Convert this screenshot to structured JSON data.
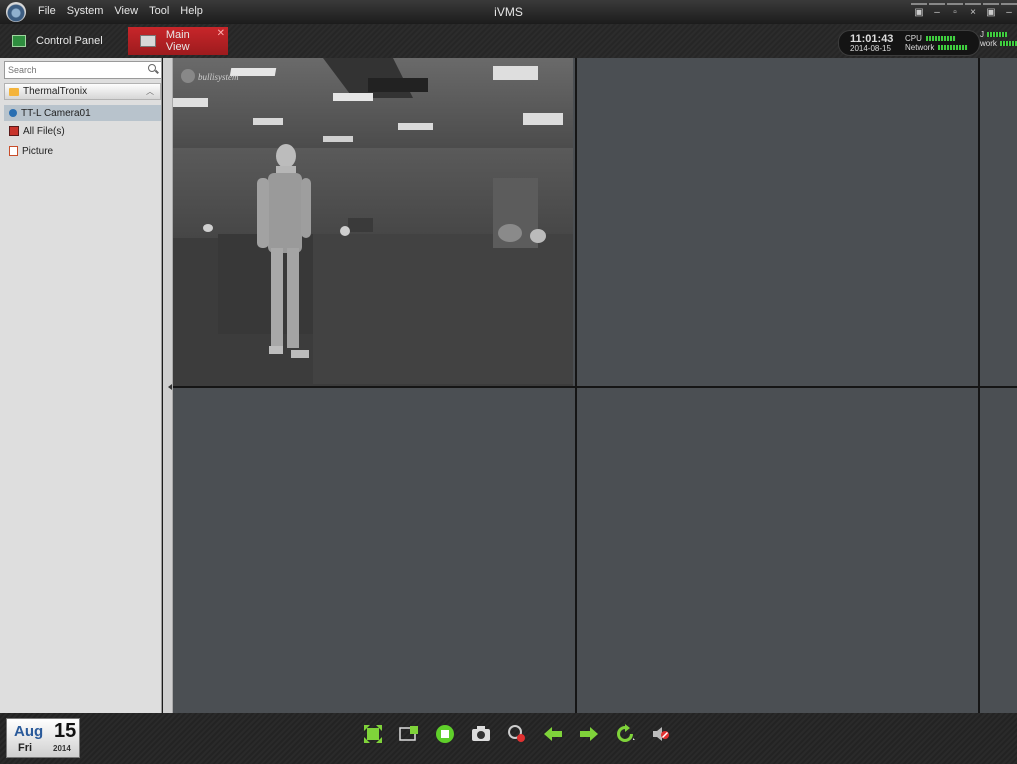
{
  "window": {
    "title": "iVMS",
    "menu": [
      "File",
      "System",
      "View",
      "Tool",
      "Help"
    ],
    "controls": [
      "lock-icon",
      "minimize-icon",
      "restore-icon",
      "close-icon"
    ]
  },
  "tabs": [
    {
      "label": "Control Panel",
      "icon": "control-panel-icon",
      "active": false
    },
    {
      "label": "Main View",
      "icon": "main-view-icon",
      "active": true
    }
  ],
  "status": {
    "time": "11:01:43",
    "date": "2014-08-15",
    "cpu_label": "CPU",
    "network_label": "Network",
    "clipped_cpu": "J",
    "clipped_network": "work"
  },
  "sidebar": {
    "search_placeholder": "Search",
    "group": "ThermalTronix",
    "items": [
      {
        "label": "TT-L Camera01",
        "icon": "camera-icon",
        "selected": true
      },
      {
        "label": "All File(s)",
        "icon": "file-icon",
        "selected": false
      },
      {
        "label": "Picture",
        "icon": "picture-icon",
        "selected": false
      }
    ]
  },
  "video": {
    "watermark": "bullisystem"
  },
  "date_widget": {
    "month": "Aug",
    "day": "15",
    "weekday": "Fri",
    "year": "2014"
  },
  "toolbar_icons": [
    "fullscreen-icon",
    "window-layout-icon",
    "stop-all-icon",
    "capture-icon",
    "record-icon",
    "previous-icon",
    "next-icon",
    "cycle-icon",
    "audio-mute-icon"
  ],
  "colors": {
    "accent_red": "#c8262a",
    "toolbar_green": "#7fd33a",
    "pane_gray": "#4b4f53"
  }
}
